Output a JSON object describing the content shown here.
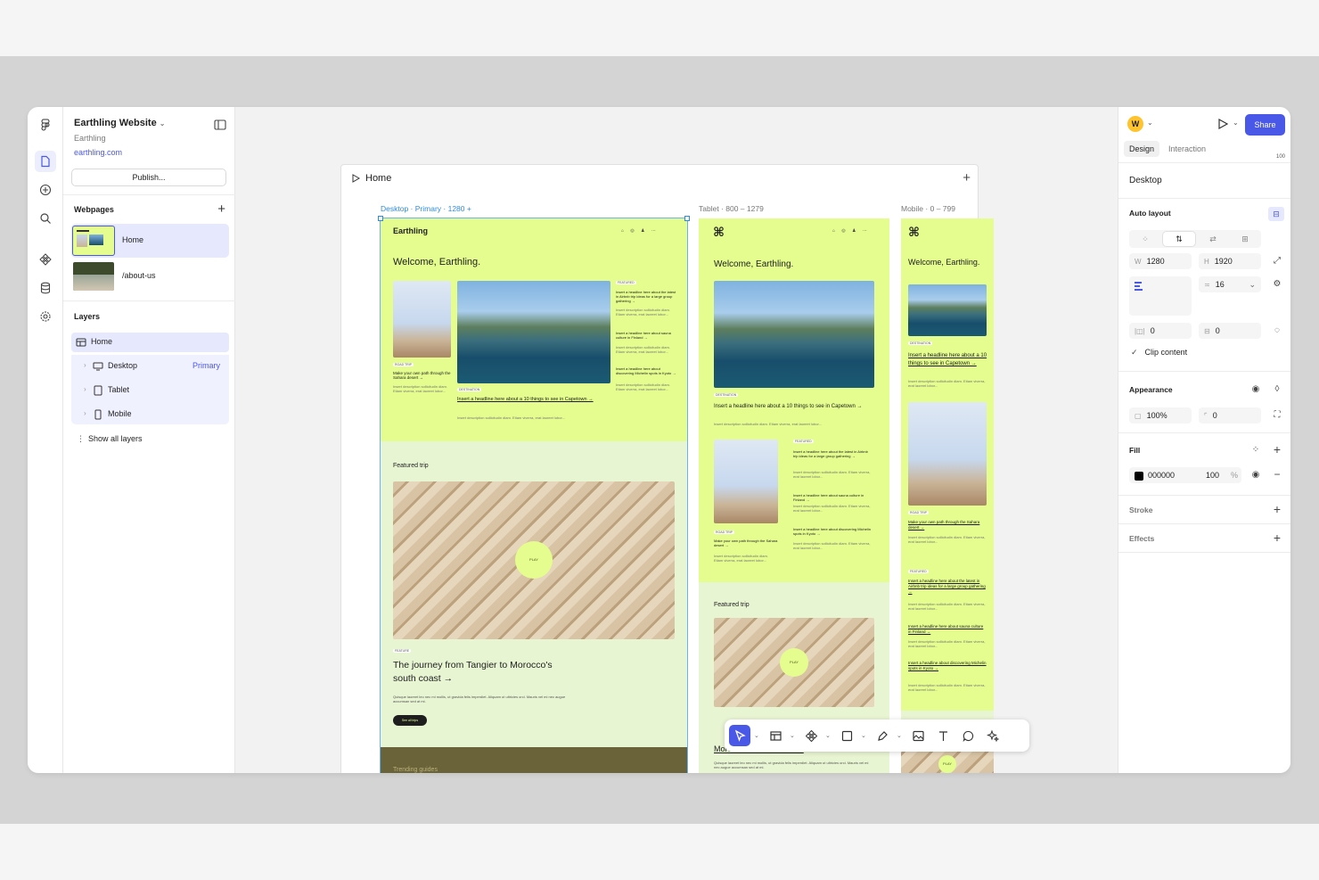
{
  "project": {
    "title": "Earthling Website",
    "team": "Earthling",
    "domain": "earthling.com",
    "publish_label": "Publish..."
  },
  "webpages": {
    "heading": "Webpages",
    "items": [
      {
        "label": "Home"
      },
      {
        "label": "/about-us"
      }
    ]
  },
  "layers": {
    "heading": "Layers",
    "home": "Home",
    "children": [
      {
        "label": "Desktop",
        "tag": "Primary"
      },
      {
        "label": "Tablet",
        "tag": ""
      },
      {
        "label": "Mobile",
        "tag": ""
      }
    ],
    "show_all": "Show all layers"
  },
  "canvas": {
    "board_title": "Home",
    "frames": {
      "desktop": {
        "name": "Desktop",
        "primary": "Primary",
        "range": "1280 +"
      },
      "tablet": {
        "name": "Tablet",
        "range": "800 – 1279"
      },
      "mobile": {
        "name": "Mobile",
        "range": "0 – 799"
      }
    },
    "site": {
      "brand": "Earthling",
      "welcome": "Welcome, Earthling.",
      "tag_featured": "FEATURED",
      "tag_destination": "DESTINATION",
      "tag_road_trip": "ROAD TRIP",
      "headline_main": "Insert a headline here about a 10 things to see in Capetown →",
      "headline_airbnb": "Insert a headline here about the latest in Airbnb trip ideas for a large group gathering →",
      "headline_sauna": "Insert a headline here about sauna culture in Finland →",
      "headline_kyoto": "Insert a headline here about discovering Michelin spots in Kyoto →",
      "headline_sahara": "Make your own path through the Sahara desert →",
      "desc": "Insert description sollicitudin diam. Etiam viverra, erat laoreet lobor...",
      "featured_trip": "Featured trip",
      "play": "PLAY",
      "feature_tag": "FEATURE",
      "journey": "The journey from Tangier to Morocco's south coast →",
      "journey_desc": "Quisque laoreet leo nec mi mollis, ut gravida felis imperdiet. Aliquam ut ultricies orci. Mauris vel mi nec augue accumsan sed at mi.",
      "see_all": "See all trips",
      "trending": "Trending guides",
      "tablet_partial": "Morocco's south coast →",
      "mobile_welcome": "Welcome, Earthling.",
      "mobile_headline": "Insert a headline here about a 10 things to see in Capetown →",
      "mobile_sahara": "Make your own path through the Sahara desert →",
      "mobile_airbnb": "Insert a headline here about the latest in Airbnb trip ideas for a large group gathering →",
      "mobile_sauna": "Insert a headline here about sauna culture in Finland →",
      "mobile_kyoto": "Insert a headline about discovering Michelin spots in Kyoto →"
    }
  },
  "toolbar": {
    "tools": [
      "select",
      "frame",
      "component",
      "shape",
      "pen",
      "image",
      "text",
      "comment",
      "ai"
    ]
  },
  "inspector": {
    "avatar": "W",
    "share": "Share",
    "tabs": [
      "Design",
      "Interaction"
    ],
    "zoom_partial": "100",
    "selection": "Desktop",
    "auto_layout": "Auto layout",
    "w_label": "W",
    "w_value": "1280",
    "h_label": "H",
    "h_value": "1920",
    "gap_value": "16",
    "pad_h": "0",
    "pad_v": "0",
    "clip_content": "Clip content",
    "appearance": "Appearance",
    "opacity": "100%",
    "radius": "0",
    "fill": "Fill",
    "fill_hex": "000000",
    "fill_opacity": "100",
    "fill_pct": "%",
    "stroke": "Stroke",
    "effects": "Effects"
  }
}
